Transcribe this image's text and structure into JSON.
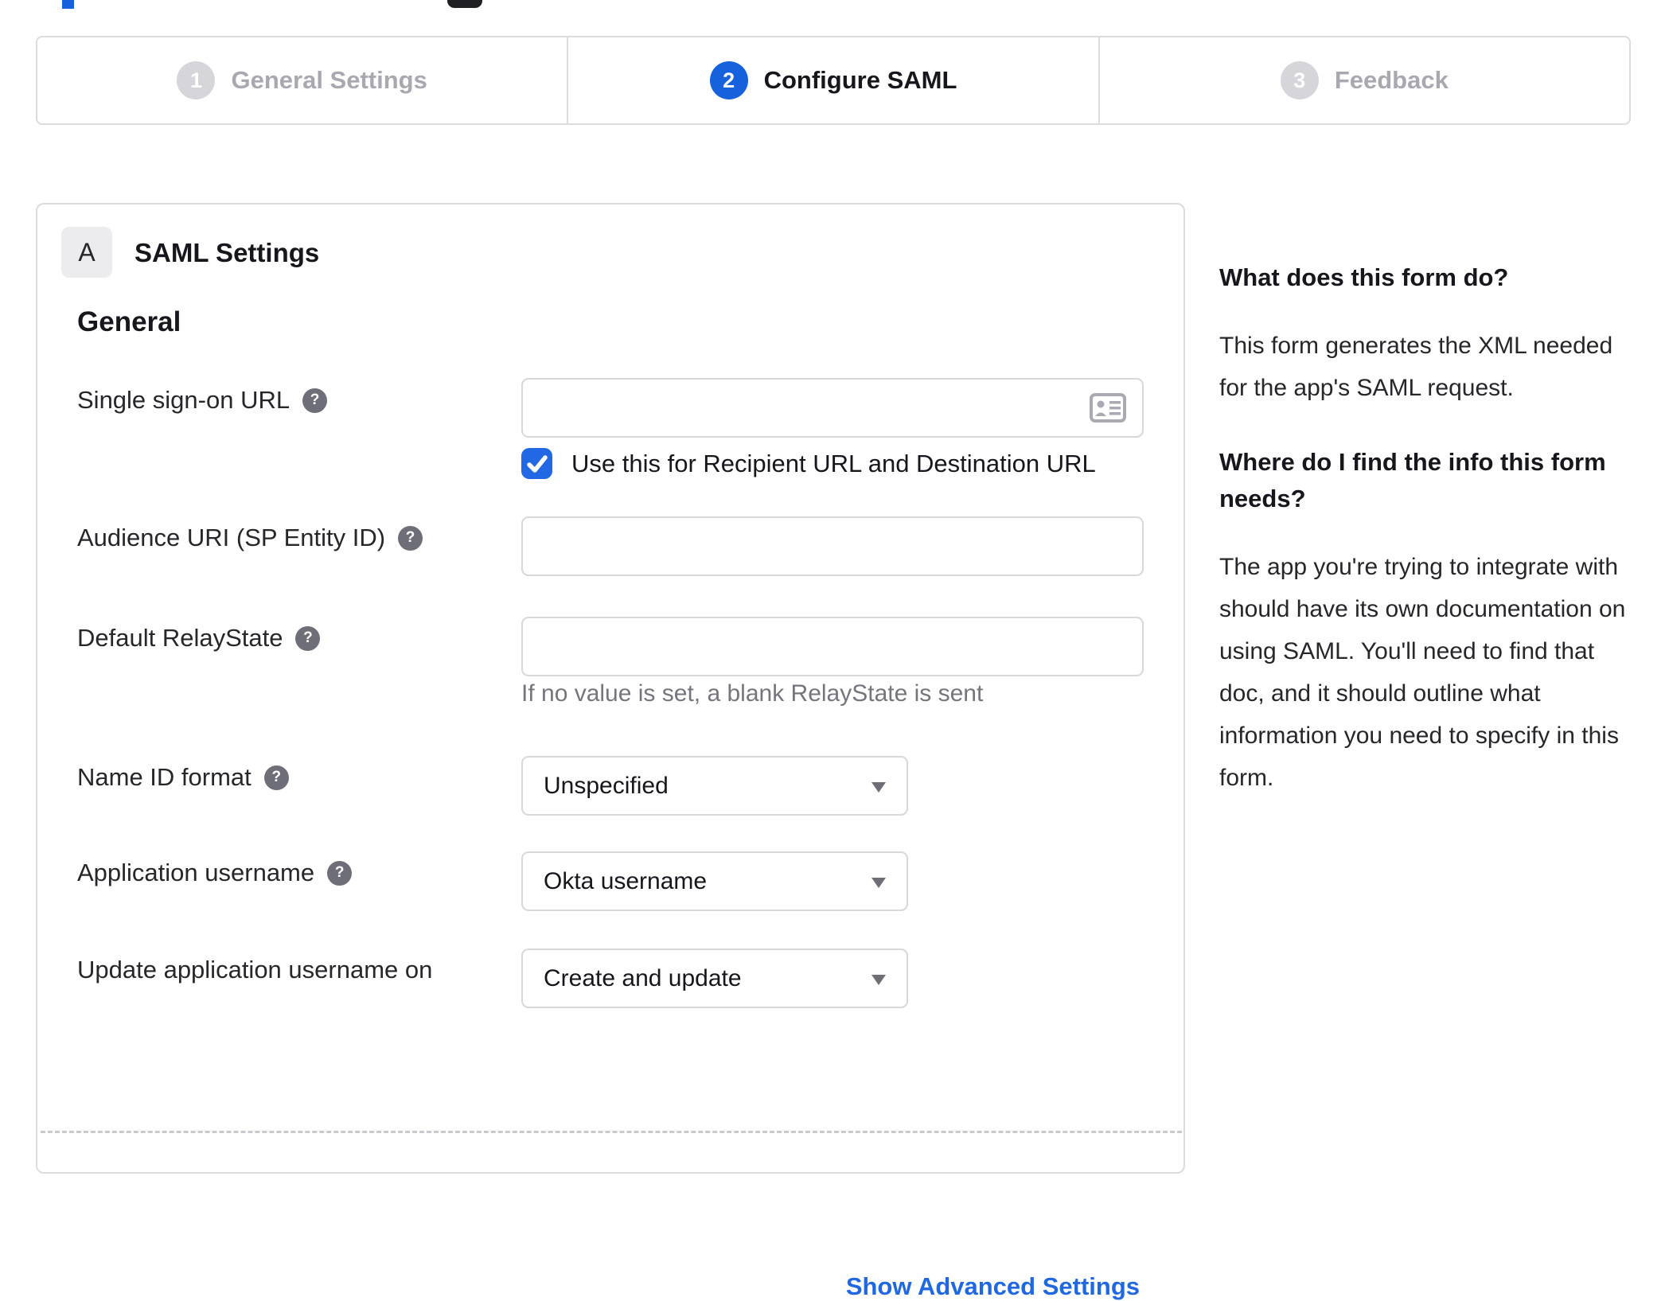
{
  "colors": {
    "accent_blue": "#1662dd",
    "checkbox_blue": "#2268e4",
    "link_blue": "#2068e0",
    "border_gray": "#dcdce0",
    "input_border_gray": "#d7d7dc",
    "text_dark": "#16161d",
    "muted_gray": "#75757d",
    "inactive_circle_gray": "#d5d5da",
    "inactive_label_gray": "#a8a8b0",
    "help_icon_gray": "#6e6e78",
    "badge_bg_gray": "#ececee"
  },
  "stepper": {
    "steps": [
      {
        "number": "1",
        "label": "General Settings",
        "active": false
      },
      {
        "number": "2",
        "label": "Configure SAML",
        "active": true
      },
      {
        "number": "3",
        "label": "Feedback",
        "active": false
      }
    ]
  },
  "panel": {
    "badge": "A",
    "title": "SAML Settings",
    "section": "General",
    "fields": [
      {
        "label": "Single sign-on URL",
        "value": "",
        "checkbox_label": "Use this for Recipient URL and Destination URL",
        "checkbox_checked": true
      },
      {
        "label": "Audience URI (SP Entity ID)",
        "value": ""
      },
      {
        "label": "Default RelayState",
        "value": "",
        "helper": "If no value is set, a blank RelayState is sent"
      },
      {
        "label": "Name ID format",
        "value": "Unspecified"
      },
      {
        "label": "Application username",
        "value": "Okta username"
      },
      {
        "label": "Update application username on",
        "value": "Create and update"
      }
    ],
    "advanced_link": "Show Advanced Settings"
  },
  "icons": {
    "help": "?"
  },
  "sidebar": {
    "sections": [
      {
        "heading": "What does this form do?",
        "body": "This form generates the XML needed for the app's SAML request."
      },
      {
        "heading": "Where do I find the info this form needs?",
        "body": "The app you're trying to integrate with should have its own documentation on using SAML. You'll need to find that doc, and it should outline what information you need to specify in this form."
      }
    ]
  }
}
